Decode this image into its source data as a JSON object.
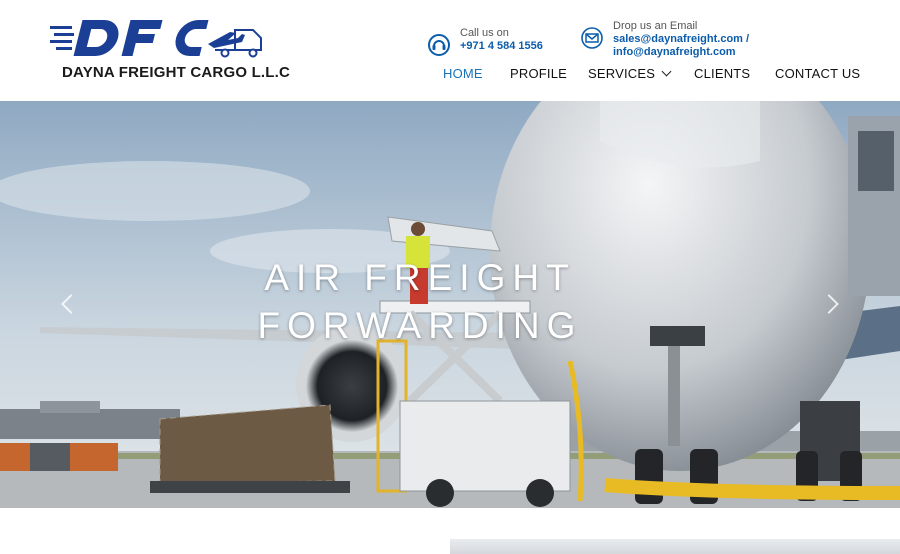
{
  "brand": {
    "logo_letters": "DFC",
    "company_name": "DAYNA FREIGHT CARGO L.L.C",
    "colors": {
      "primary_blue": "#1b3f95",
      "nav_active": "#1673b8",
      "link_blue": "#0b5cab"
    }
  },
  "contact": {
    "phone": {
      "icon": "phone-headset-icon",
      "label": "Call us on",
      "value": "+971 4 584 1556"
    },
    "email": {
      "icon": "envelope-icon",
      "label": "Drop us an Email",
      "value_line1": "sales@daynafreight.com /",
      "value_line2": "info@daynafreight.com"
    }
  },
  "nav": {
    "items": [
      {
        "label": "HOME",
        "active": true
      },
      {
        "label": "PROFILE",
        "active": false
      },
      {
        "label": "SERVICES",
        "active": false,
        "has_dropdown": true
      },
      {
        "label": "CLIENTS",
        "active": false
      },
      {
        "label": "CONTACT US",
        "active": false
      }
    ]
  },
  "hero": {
    "title_line1": "AIR FREIGHT",
    "title_line2": "FORWARDING",
    "prev_icon": "chevron-left-icon",
    "next_icon": "chevron-right-icon"
  }
}
